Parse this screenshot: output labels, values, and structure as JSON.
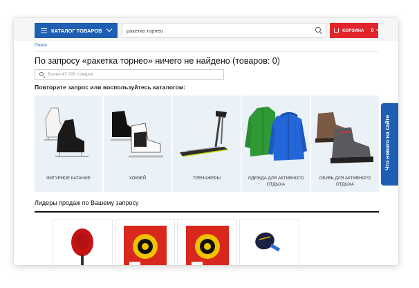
{
  "header": {
    "catalog_label": "КАТАЛОГ ТОВАРОВ",
    "search_value": "ракетка торнео",
    "cart_label": "КОРЗИНА",
    "cart_count": "0",
    "cart_caret": "▾"
  },
  "breadcrumb": "Поиск",
  "page_title": "По запросу «ракетка торнео» ничего не найдено (товаров: 0)",
  "inner_search": {
    "placeholder": "Более 47 000 товаров"
  },
  "subtitle": "Повторите запрос или воспользуйтесь каталогом:",
  "categories": [
    {
      "label": "Фигурное катание",
      "icon": "figure-skates-image"
    },
    {
      "label": "Хоккей",
      "icon": "hockey-skates-image"
    },
    {
      "label": "Тренажеры",
      "icon": "treadmill-image"
    },
    {
      "label": "Одежда для активного отдыха",
      "icon": "jackets-image"
    },
    {
      "label": "Обувь для активного отдыха",
      "icon": "hiking-boots-image"
    }
  ],
  "whats_new": "Что нового на сайте",
  "leaders_title": "Лидеры продаж по Вашему запросу",
  "products": [
    {
      "icon": "red-table-tennis-racket-image"
    },
    {
      "icon": "racket-rubber-pack-image"
    },
    {
      "icon": "racket-rubber-pack-image"
    },
    {
      "icon": "blue-table-tennis-racket-image"
    }
  ],
  "colors": {
    "primary": "#1e5fb4",
    "cart": "#e2242b",
    "category_bg": "#eaf1f7"
  }
}
